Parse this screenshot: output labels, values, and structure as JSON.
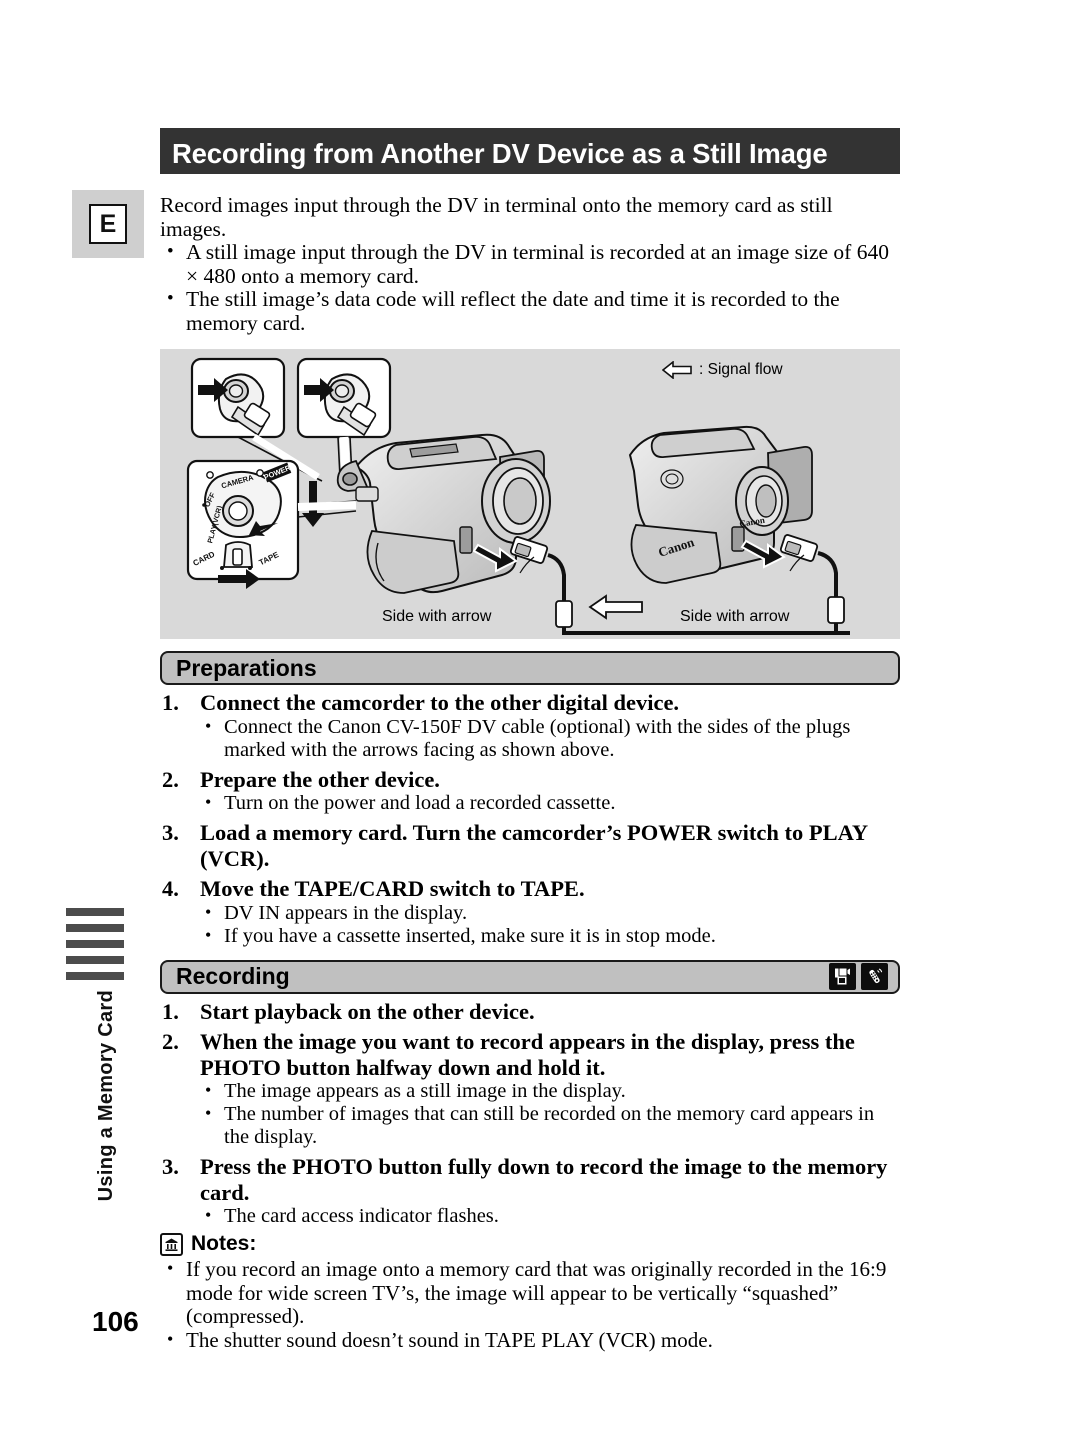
{
  "page": {
    "number": "106",
    "language_tab": "E",
    "chapter_label": "Using a Memory Card"
  },
  "title": "Recording from Another DV Device as a Still Image",
  "intro": {
    "paragraph": "Record images input through the DV in terminal onto the memory card as still images.",
    "bullets": [
      "A still image input through the DV in terminal is recorded at an image size of 640 × 480 onto a memory card.",
      "The still image’s data code will reflect the date and time it is recorded to the memory card."
    ]
  },
  "figure": {
    "legend_text": ": Signal flow",
    "legend_icon": "left-arrow-outline-icon",
    "caption_left": "Side with arrow",
    "caption_right": "Side with arrow",
    "dial_labels": {
      "camera": "CAMERA",
      "off": "OFF",
      "play_vcr": "PLAY(VCR)",
      "power": "POWER",
      "card": "CARD",
      "tape": "TAPE"
    },
    "brand_left": "Canon",
    "brand_right": "Canon",
    "panel_color": "#d9d9d9"
  },
  "preparations": {
    "heading": "Preparations",
    "steps": [
      {
        "num": "1.",
        "text": "Connect the camcorder to the other digital device.",
        "subs": [
          "Connect the Canon CV-150F DV cable (optional) with the sides of the plugs marked with the arrows facing as shown above."
        ]
      },
      {
        "num": "2.",
        "text": "Prepare the other device.",
        "subs": [
          "Turn on the power and load a recorded cassette."
        ]
      },
      {
        "num": "3.",
        "text": "Load a memory card. Turn the camcorder’s POWER switch to PLAY (VCR).",
        "subs": []
      },
      {
        "num": "4.",
        "text": "Move the TAPE/CARD switch to TAPE.",
        "subs": [
          "DV IN appears in the display.",
          "If you have a cassette inserted, make sure it is in stop mode."
        ]
      }
    ]
  },
  "recording": {
    "heading": "Recording",
    "icons": [
      "camcorder-icon",
      "remote-control-icon"
    ],
    "steps": [
      {
        "num": "1.",
        "text": "Start playback on the other device.",
        "subs": []
      },
      {
        "num": "2.",
        "text": "When the image you want to record appears in the display, press the PHOTO button halfway down and hold it.",
        "subs": [
          "The image appears as a still image in the display.",
          "The number of images that can still be recorded on the memory card appears in the display."
        ]
      },
      {
        "num": "3.",
        "text": "Press the PHOTO button fully down to record the image to the memory card.",
        "subs": [
          "The card access indicator flashes."
        ]
      }
    ]
  },
  "notes": {
    "title": "Notes:",
    "icon": "memory-card-icon",
    "items": [
      "If you record an image onto a memory card that was originally recorded in the 16:9 mode for wide screen TV’s, the image will appear to be vertically “squashed” (compressed).",
      "The shutter sound doesn’t sound in TAPE PLAY (VCR) mode."
    ]
  },
  "colors": {
    "title_bar": "#333333",
    "section_pill": "#c0c0c0",
    "figure_panel": "#d9d9d9",
    "chapter_bar": "#4c4c4c"
  }
}
